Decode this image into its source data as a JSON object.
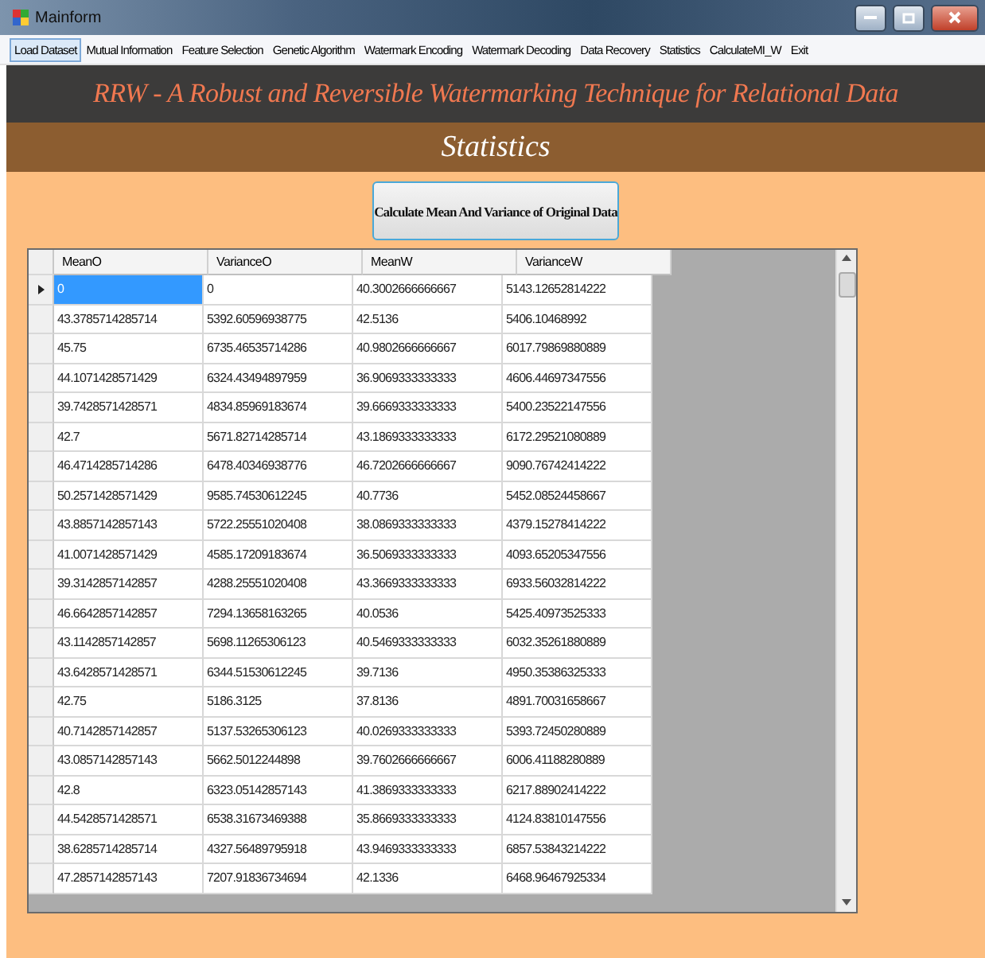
{
  "window": {
    "title": "Mainform"
  },
  "menu": [
    {
      "label": "Load Dataset",
      "selected": true
    },
    {
      "label": "Mutual Information",
      "selected": false
    },
    {
      "label": "Feature Selection",
      "selected": false
    },
    {
      "label": "Genetic Algorithm",
      "selected": false
    },
    {
      "label": "Watermark Encoding",
      "selected": false
    },
    {
      "label": "Watermark Decoding",
      "selected": false
    },
    {
      "label": "Data Recovery",
      "selected": false
    },
    {
      "label": "Statistics",
      "selected": false
    },
    {
      "label": "CalculateMI_W",
      "selected": false
    },
    {
      "label": "Exit",
      "selected": false
    }
  ],
  "header": {
    "title": "RRW - A Robust and Reversible Watermarking Technique for Relational Data",
    "subtitle": "Statistics"
  },
  "action_button": "Calculate Mean And Variance of Original Data",
  "table": {
    "columns": [
      "MeanO",
      "VarianceO",
      "MeanW",
      "VarianceW"
    ],
    "rows": [
      {
        "selected": true,
        "cells": [
          "0",
          "0",
          "40.3002666666667",
          "5143.12652814222"
        ]
      },
      {
        "selected": false,
        "cells": [
          "43.3785714285714",
          "5392.60596938775",
          "42.5136",
          "5406.10468992"
        ]
      },
      {
        "selected": false,
        "cells": [
          "45.75",
          "6735.46535714286",
          "40.9802666666667",
          "6017.79869880889"
        ]
      },
      {
        "selected": false,
        "cells": [
          "44.1071428571429",
          "6324.43494897959",
          "36.9069333333333",
          "4606.44697347556"
        ]
      },
      {
        "selected": false,
        "cells": [
          "39.7428571428571",
          "4834.85969183674",
          "39.6669333333333",
          "5400.23522147556"
        ]
      },
      {
        "selected": false,
        "cells": [
          "42.7",
          "5671.82714285714",
          "43.1869333333333",
          "6172.29521080889"
        ]
      },
      {
        "selected": false,
        "cells": [
          "46.4714285714286",
          "6478.40346938776",
          "46.7202666666667",
          "9090.76742414222"
        ]
      },
      {
        "selected": false,
        "cells": [
          "50.2571428571429",
          "9585.74530612245",
          "40.7736",
          "5452.08524458667"
        ]
      },
      {
        "selected": false,
        "cells": [
          "43.8857142857143",
          "5722.25551020408",
          "38.0869333333333",
          "4379.15278414222"
        ]
      },
      {
        "selected": false,
        "cells": [
          "41.0071428571429",
          "4585.17209183674",
          "36.5069333333333",
          "4093.65205347556"
        ]
      },
      {
        "selected": false,
        "cells": [
          "39.3142857142857",
          "4288.25551020408",
          "43.3669333333333",
          "6933.56032814222"
        ]
      },
      {
        "selected": false,
        "cells": [
          "46.6642857142857",
          "7294.13658163265",
          "40.0536",
          "5425.40973525333"
        ]
      },
      {
        "selected": false,
        "cells": [
          "43.1142857142857",
          "5698.11265306123",
          "40.5469333333333",
          "6032.35261880889"
        ]
      },
      {
        "selected": false,
        "cells": [
          "43.6428571428571",
          "6344.51530612245",
          "39.7136",
          "4950.35386325333"
        ]
      },
      {
        "selected": false,
        "cells": [
          "42.75",
          "5186.3125",
          "37.8136",
          "4891.70031658667"
        ]
      },
      {
        "selected": false,
        "cells": [
          "40.7142857142857",
          "5137.53265306123",
          "40.0269333333333",
          "5393.72450280889"
        ]
      },
      {
        "selected": false,
        "cells": [
          "43.0857142857143",
          "5662.5012244898",
          "39.7602666666667",
          "6006.41188280889"
        ]
      },
      {
        "selected": false,
        "cells": [
          "42.8",
          "6323.05142857143",
          "41.3869333333333",
          "6217.88902414222"
        ]
      },
      {
        "selected": false,
        "cells": [
          "44.5428571428571",
          "6538.31673469388",
          "35.8669333333333",
          "4124.83810147556"
        ]
      },
      {
        "selected": false,
        "cells": [
          "38.6285714285714",
          "4327.56489795918",
          "43.9469333333333",
          "6857.53843214222"
        ]
      },
      {
        "selected": false,
        "cells": [
          "47.2857142857143",
          "7207.91836734694",
          "42.1336",
          "6468.96467925334"
        ]
      }
    ]
  }
}
